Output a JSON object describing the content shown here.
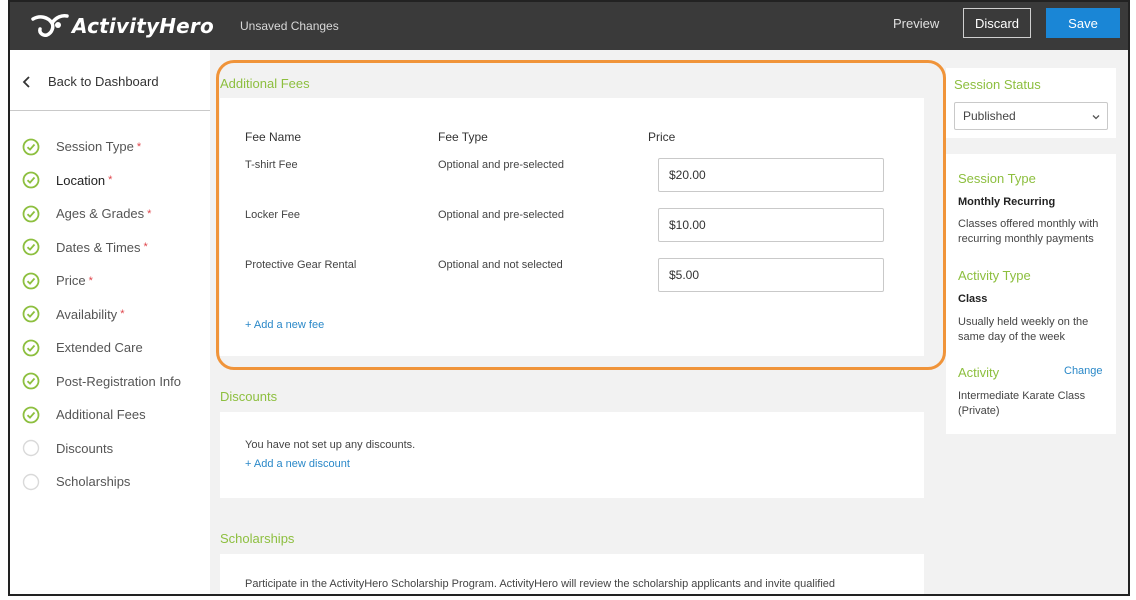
{
  "header": {
    "logo_text": "ActivityHero",
    "status": "Unsaved Changes",
    "preview_label": "Preview",
    "discard_label": "Discard",
    "save_label": "Save"
  },
  "sidebar": {
    "back_label": "Back to Dashboard",
    "items": [
      {
        "label": "Session Type",
        "required": "*",
        "done": true
      },
      {
        "label": "Location",
        "required": "*",
        "done": true
      },
      {
        "label": "Ages & Grades",
        "required": "*",
        "done": true
      },
      {
        "label": "Dates & Times",
        "required": "*",
        "done": true
      },
      {
        "label": "Price",
        "required": "*",
        "done": true
      },
      {
        "label": "Availability",
        "required": "*",
        "done": true
      },
      {
        "label": "Extended Care",
        "required": "",
        "done": true
      },
      {
        "label": "Post-Registration Info",
        "required": "",
        "done": true
      },
      {
        "label": "Additional Fees",
        "required": "",
        "done": true
      },
      {
        "label": "Discounts",
        "required": "",
        "done": false
      },
      {
        "label": "Scholarships",
        "required": "",
        "done": false
      }
    ]
  },
  "additional_fees": {
    "title": "Additional Fees",
    "columns": [
      "Fee Name",
      "Fee Type",
      "Price"
    ],
    "rows": [
      {
        "name": "T-shirt Fee",
        "type": "Optional and pre-selected",
        "price": "$20.00"
      },
      {
        "name": "Locker Fee",
        "type": "Optional and pre-selected",
        "price": "$10.00"
      },
      {
        "name": "Protective Gear Rental",
        "type": "Optional and not selected",
        "price": "$5.00"
      }
    ],
    "add_link": "+ Add a new fee"
  },
  "discounts": {
    "title": "Discounts",
    "empty_text": "You have not set up any discounts.",
    "add_link": "+ Add a new discount"
  },
  "scholarships": {
    "title": "Scholarships",
    "text": "Participate in the ActivityHero Scholarship Program. ActivityHero will review the scholarship applicants and invite qualified applicants to register for your program at the scholarship price you specify below."
  },
  "right_panel": {
    "session_status_title": "Session Status",
    "session_status_value": "Published",
    "session_type_title": "Session Type",
    "session_type_value": "Monthly Recurring",
    "session_type_desc": "Classes offered monthly with recurring monthly payments",
    "activity_type_title": "Activity Type",
    "activity_type_value": "Class",
    "activity_type_desc": "Usually held weekly on the same day of the week",
    "activity_title": "Activity",
    "activity_change": "Change",
    "activity_value": "Intermediate Karate Class (Private)"
  },
  "colors": {
    "accent_green": "#8dbf3f",
    "link_blue": "#2a88c8",
    "save_blue": "#1a86d6",
    "highlight_orange": "#f0943a",
    "required_red": "#e0454b"
  }
}
